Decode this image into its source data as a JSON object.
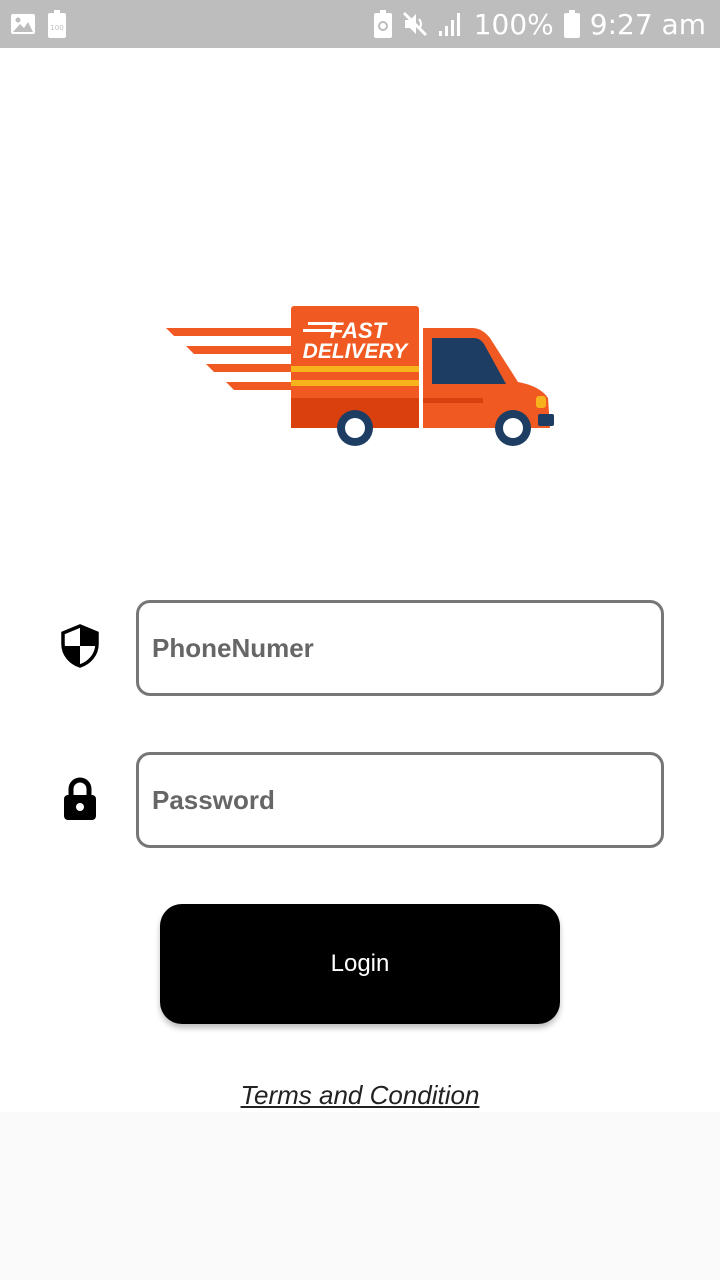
{
  "status_bar": {
    "battery_percent": "100%",
    "time": "9:27 am",
    "icons": [
      "gallery-icon",
      "battery-saver-icon",
      "recycle-battery-icon",
      "mute-icon",
      "signal-icon",
      "battery-icon"
    ]
  },
  "logo": {
    "line1": "FAST",
    "line2": "DELIVERY",
    "colors": {
      "orange": "#f05a22",
      "dark_orange": "#d9400e",
      "yellow": "#f7b31b",
      "navy": "#1d3d63"
    }
  },
  "form": {
    "phone": {
      "placeholder": "PhoneNumer",
      "value": "",
      "icon": "shield-icon"
    },
    "password": {
      "placeholder": "Password",
      "value": "",
      "icon": "lock-icon"
    },
    "login_label": "Login",
    "terms_label": "Terms and Condition"
  },
  "colors": {
    "status_bar_bg": "#bdbdbd",
    "field_border": "#767676",
    "button_bg": "#000000",
    "button_text": "#ffffff",
    "bottom_area": "#fafafa"
  }
}
